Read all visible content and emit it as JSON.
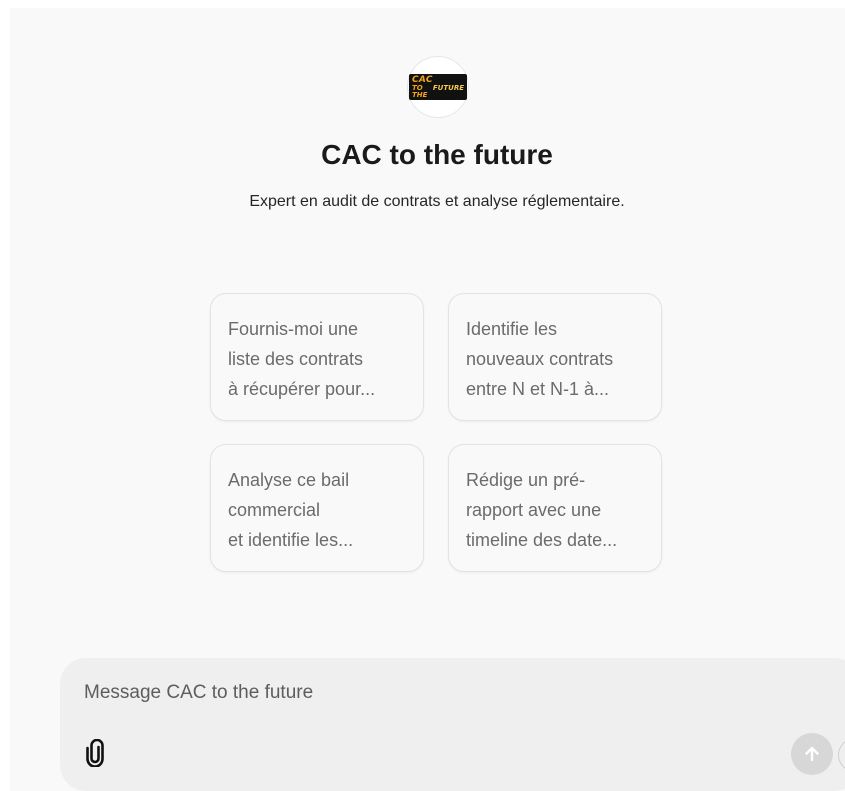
{
  "gpt": {
    "logo_line1": "CAC",
    "logo_line2a": "TO THE",
    "logo_line2b": "FUTURE",
    "name": "CAC to the future",
    "description": "Expert en audit de contrats et analyse réglementaire."
  },
  "suggestions": [
    {
      "lines": [
        "Fournis-moi une",
        "liste des contrats",
        "à récupérer pour..."
      ]
    },
    {
      "lines": [
        "Identifie les",
        "nouveaux contrats",
        "entre N et N-1 à..."
      ]
    },
    {
      "lines": [
        "Analyse ce bail",
        "commercial",
        "et identifie les..."
      ]
    },
    {
      "lines": [
        "Rédige un pré-",
        "rapport avec une",
        "timeline des date..."
      ]
    }
  ],
  "composer": {
    "placeholder": "Message CAC to the future",
    "value": ""
  },
  "icons": {
    "attach": "paperclip-icon",
    "send": "arrow-up-icon"
  },
  "colors": {
    "background": "#f9f9f9",
    "composer": "#efefef",
    "send_disabled": "#d7d7d7"
  }
}
